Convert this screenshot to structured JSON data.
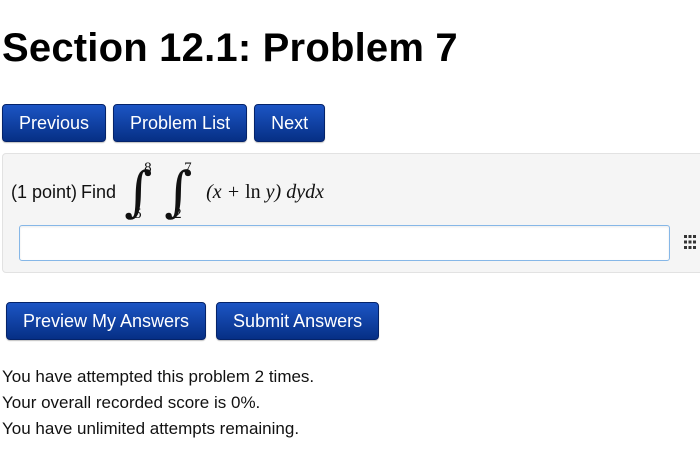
{
  "header": {
    "title": "Section 12.1: Problem 7"
  },
  "nav": {
    "previous_label": "Previous",
    "problem_list_label": "Problem List",
    "next_label": "Next"
  },
  "problem": {
    "points": "(1 point)",
    "prompt": "Find",
    "integral_outer_upper": "8",
    "integral_outer_lower": "5",
    "integral_inner_upper": "7",
    "integral_inner_lower": "2",
    "integrand_open": "(x + ",
    "integrand_ln": "ln",
    "integrand_close": " y) dydx",
    "answer_value": "",
    "answer_placeholder": ""
  },
  "actions": {
    "preview_label": "Preview My Answers",
    "submit_label": "Submit Answers"
  },
  "status": {
    "attempts": "You have attempted this problem 2 times.",
    "score": "Your overall recorded score is 0%.",
    "remaining": "You have unlimited attempts remaining."
  },
  "icons": {
    "equation_editor": "grid-icon"
  },
  "colors": {
    "button_bg": "#083b9b",
    "panel_bg": "#f5f5f5",
    "input_border": "#86b7e7"
  }
}
